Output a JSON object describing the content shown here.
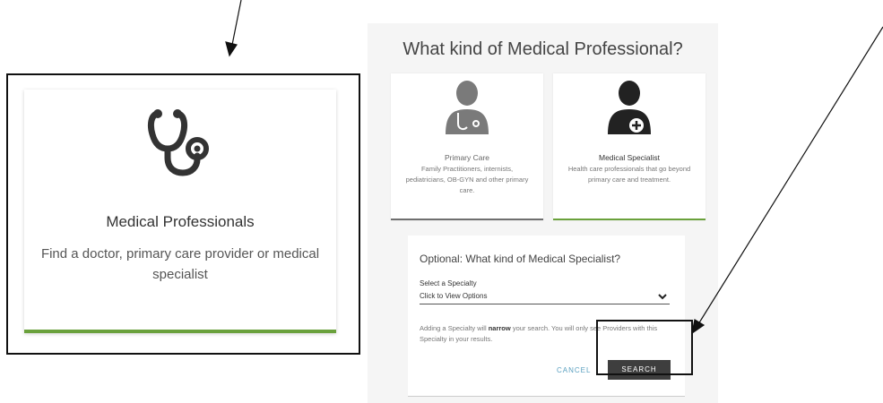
{
  "left_card": {
    "icon": "stethoscope-icon",
    "title": "Medical Professionals",
    "description": "Find a doctor, primary care provider or medical specialist",
    "accent_color": "#6aa13c"
  },
  "panel": {
    "heading": "What kind of Medical Professional?",
    "cards": [
      {
        "icon": "person-icon",
        "title": "Primary Care",
        "description": "Family Practitioners, internists, pediatricians, OB-GYN and other primary care."
      },
      {
        "icon": "person-plus-icon",
        "title": "Medical Specialist",
        "description": "Health care professionals that go beyond primary care and treatment.",
        "selected": true
      }
    ],
    "optional": {
      "title": "Optional: What kind of Medical Specialist?",
      "select_label": "Select a Specialty",
      "select_value": "Click to View Options",
      "note_before": "Adding a Specialty will ",
      "note_bold": "narrow",
      "note_after": " your search. You will only see Providers with this Specialty in your results.",
      "cancel_label": "CANCEL",
      "search_label": "SEARCH"
    }
  }
}
